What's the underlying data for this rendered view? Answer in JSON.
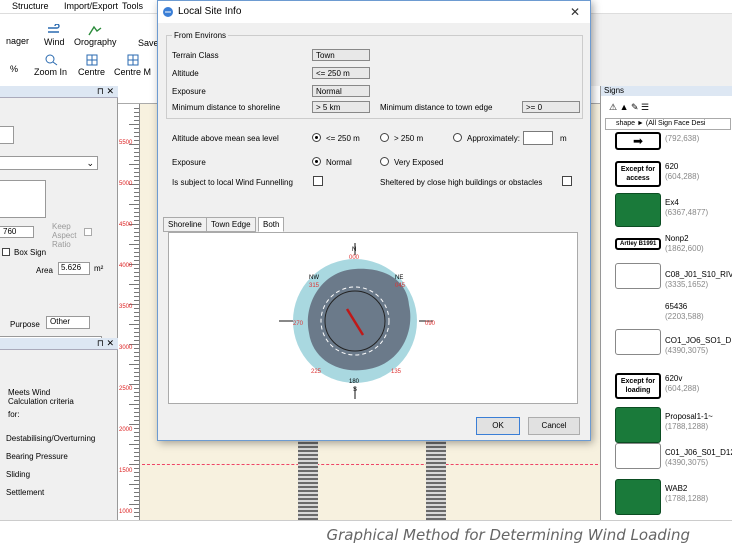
{
  "menu": {
    "structure": "Structure",
    "import_export": "Import/Export",
    "tools": "Tools"
  },
  "ribbon": {
    "manager": "nager",
    "wind": "Wind",
    "orography": "Orography",
    "save": "Save",
    "percent": "%",
    "zoom_in": "Zoom In",
    "centre": "Centre",
    "centre_m": "Centre M"
  },
  "left_panel": {
    "keep_aspect_ratio": "Keep Aspect Ratio",
    "dim_value": "760",
    "box_sign": "Box Sign",
    "area_label": "Area",
    "area_value": "5.626",
    "area_unit": "m²",
    "purpose_label": "Purpose",
    "purpose_value": "Other",
    "meets_wind": "Meets Wind",
    "calc_criteria": "Calculation criteria",
    "for": "for:",
    "items": [
      "Destabilising/Overturning",
      "Bearing Pressure",
      "Sliding",
      "Settlement"
    ]
  },
  "ruler_labels": [
    "5500",
    "5000",
    "4500",
    "4000",
    "3500",
    "3000",
    "2500",
    "2000",
    "1500",
    "1000",
    "500"
  ],
  "signs": {
    "title": "Signs",
    "filter": "shape ► (All Sign Face Desi",
    "items": [
      {
        "name": "",
        "sub": "(792,638)"
      },
      {
        "name": "620",
        "sub": "(604,288)"
      },
      {
        "name": "Ex4",
        "sub": "(6367,4877)"
      },
      {
        "name": "Nonp2",
        "sub": "(1862,600)"
      },
      {
        "name": "C08_J01_S10_RIV",
        "sub": "(3335,1652)"
      },
      {
        "name": "65436",
        "sub": "(2203,588)"
      },
      {
        "name": "CO1_JO6_SO1_D",
        "sub": "(4390,3075)"
      },
      {
        "name": "620v",
        "sub": "(604,288)"
      },
      {
        "name": "Proposal1-1~",
        "sub": "(1788,1288)"
      },
      {
        "name": "C01_J06_S01_D12",
        "sub": "(4390,3075)"
      },
      {
        "name": "WAB2",
        "sub": "(1788,1288)"
      }
    ],
    "except_for": "Except for",
    "access": "access",
    "loading": "loading",
    "artley": "Artley B1991"
  },
  "dialog": {
    "title": "Local Site Info",
    "close": "✕",
    "group": "From Environs",
    "terrain_class_label": "Terrain Class",
    "terrain_class": "Town",
    "altitude_label": "Altitude",
    "altitude": "<= 250 m",
    "exposure_label": "Exposure",
    "exposure": "Normal",
    "min_shore_label": "Minimum distance to shoreline",
    "min_shore": "> 5 km",
    "min_town_label": "Minimum distance to town edge",
    "min_town": ">= 0",
    "alt_msl_label": "Altitude above mean sea level",
    "alt_opt1": "<= 250 m",
    "alt_opt2": "> 250 m",
    "alt_opt3": "Approximately:",
    "alt_unit": "m",
    "exposure2_label": "Exposure",
    "exp_opt1": "Normal",
    "exp_opt2": "Very Exposed",
    "funnelling_label": "Is subject to local Wind Funnelling",
    "sheltered_label": "Sheltered by close high buildings or obstacles",
    "tabs": [
      "Shoreline",
      "Town Edge",
      "Both"
    ],
    "compass": {
      "n": "N",
      "n_val": "000",
      "s": "S",
      "s_val": "180",
      "e_val": "090",
      "w_val": "270",
      "nw": "NW",
      "nw_val": "315",
      "ne": "NE",
      "ne_val": "045",
      "sw_val": "225",
      "se_val": "135"
    },
    "ok": "OK",
    "cancel": "Cancel"
  },
  "caption": "Graphical Method for Determining Wind Loading"
}
